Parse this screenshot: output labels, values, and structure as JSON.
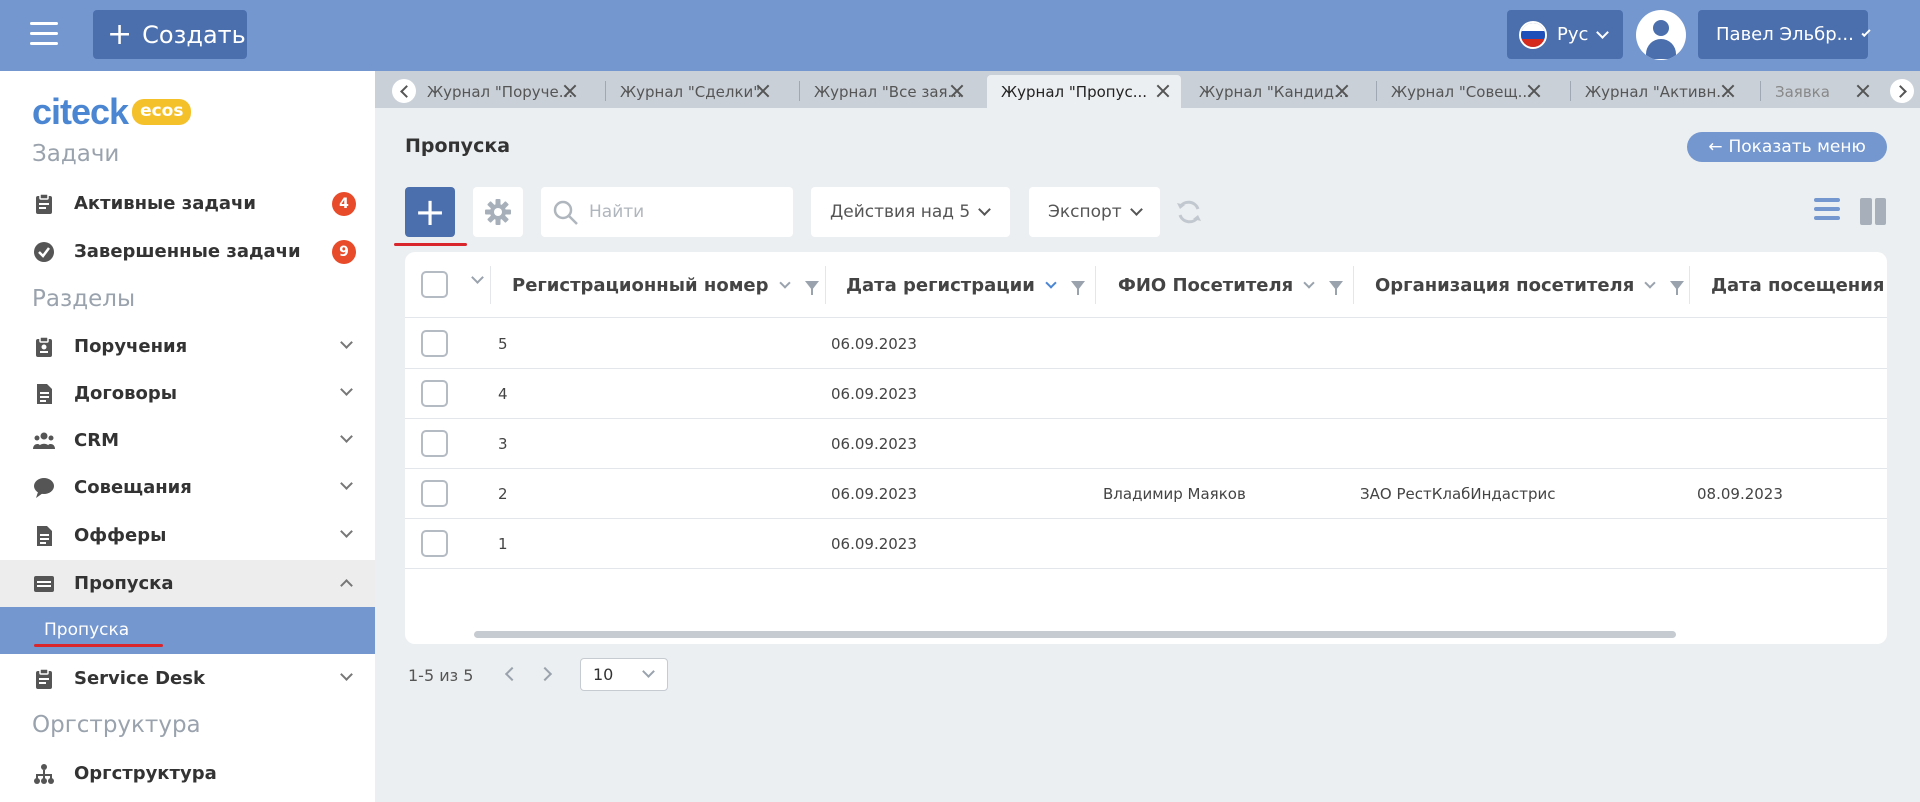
{
  "header": {
    "create_label": "Создать",
    "lang_label": "Рус",
    "user_label": "Павел Эльбр..."
  },
  "sidebar": {
    "logo": {
      "main": "citeck",
      "badge": "ecos"
    },
    "sections": {
      "tasks": "Задачи",
      "sections": "Разделы",
      "orgstructure": "Оргструктура"
    },
    "items": [
      {
        "label": "Активные задачи",
        "badge": "4",
        "icon": "clipboard-icon"
      },
      {
        "label": "Завершенные задачи",
        "badge": "9",
        "icon": "check-circle-icon"
      },
      {
        "label": "Поручения",
        "icon": "clipboard-icon"
      },
      {
        "label": "Договоры",
        "icon": "document-icon"
      },
      {
        "label": "CRM",
        "icon": "users-icon"
      },
      {
        "label": "Совещания",
        "icon": "chat-bubble-icon"
      },
      {
        "label": "Офферы",
        "icon": "document-icon"
      },
      {
        "label": "Пропуска",
        "icon": "card-icon"
      },
      {
        "label": "Service Desk",
        "icon": "clipboard-icon"
      },
      {
        "label": "Оргструктура",
        "icon": "org-chart-icon"
      }
    ],
    "sub_active": "Пропуска"
  },
  "tabs": [
    {
      "label": "Журнал \"Поруче..."
    },
    {
      "label": "Журнал \"Сделки\""
    },
    {
      "label": "Журнал \"Все зая..."
    },
    {
      "label": "Журнал \"Пропус...",
      "active": true
    },
    {
      "label": "Журнал \"Кандид..."
    },
    {
      "label": "Журнал \"Совещ..."
    },
    {
      "label": "Журнал \"Активн..."
    },
    {
      "label": "Заявка"
    }
  ],
  "page": {
    "title": "Пропуска",
    "show_menu_label": "Показать меню"
  },
  "toolbar": {
    "add_label": "+",
    "search_placeholder": "Найти",
    "actions_label": "Действия над 5",
    "export_label": "Экспорт"
  },
  "table": {
    "columns": [
      "Регистрационный номер",
      "Дата регистрации",
      "ФИО Посетителя",
      "Организация посетителя",
      "Дата посещения"
    ],
    "sorted_column": "Дата регистрации",
    "rows": [
      {
        "number": "5",
        "reg_date": "06.09.2023",
        "visitor": "",
        "org": "",
        "visit_date": ""
      },
      {
        "number": "4",
        "reg_date": "06.09.2023",
        "visitor": "",
        "org": "",
        "visit_date": ""
      },
      {
        "number": "3",
        "reg_date": "06.09.2023",
        "visitor": "",
        "org": "",
        "visit_date": ""
      },
      {
        "number": "2",
        "reg_date": "06.09.2023",
        "visitor": "Владимир Маяков",
        "org": "ЗАО РестКлабИндастрис",
        "visit_date": "08.09.2023"
      },
      {
        "number": "1",
        "reg_date": "06.09.2023",
        "visitor": "",
        "org": "",
        "visit_date": ""
      }
    ]
  },
  "pagination": {
    "range_text": "1-5 из 5",
    "page_size": "10"
  },
  "colors": {
    "header_bg": "#7497cf",
    "button_bg": "#4b6fad",
    "badge_red": "#e84b2a",
    "accent_underline": "#d9262d"
  }
}
